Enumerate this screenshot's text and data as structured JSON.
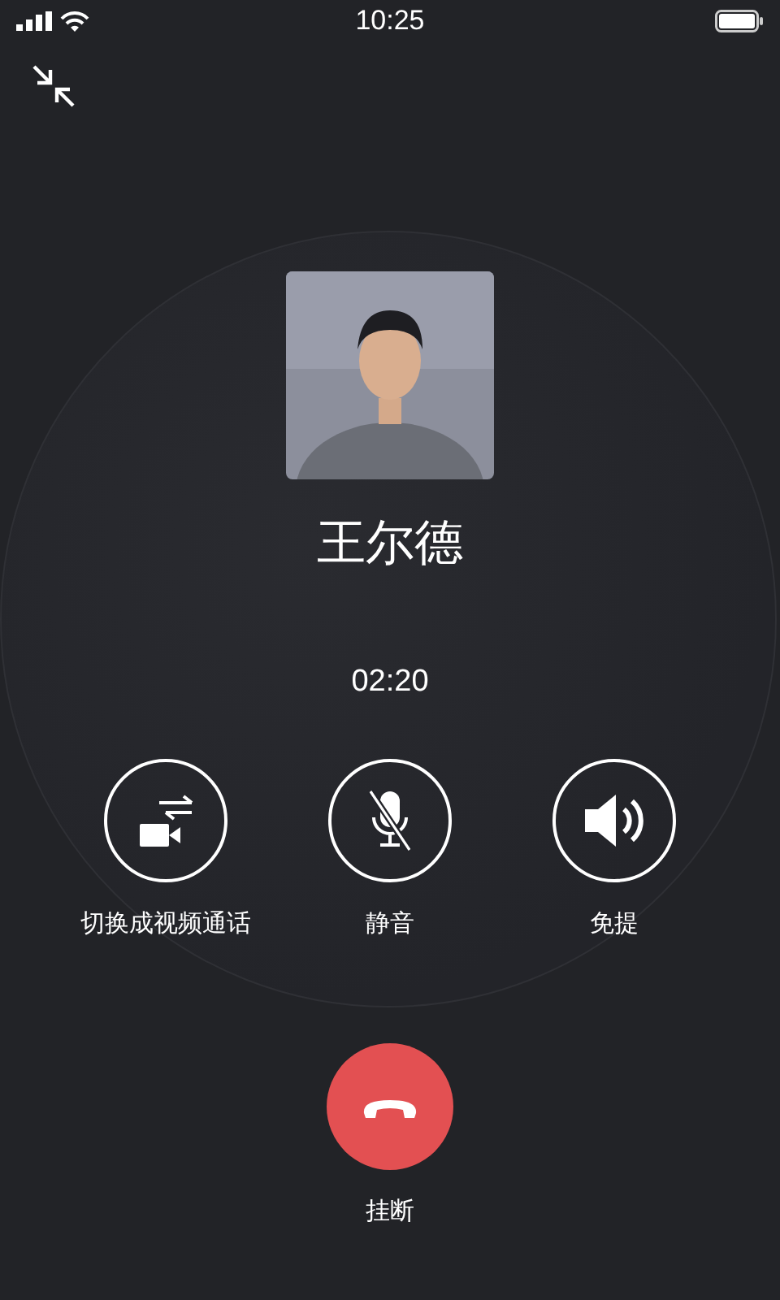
{
  "status_bar": {
    "time": "10:25"
  },
  "contact": {
    "name": "王尔德"
  },
  "call_duration": "02:20",
  "actions": [
    {
      "kind": "video",
      "label": "切换成视频通话"
    },
    {
      "kind": "mute",
      "label": "静音"
    },
    {
      "kind": "speaker",
      "label": "免提"
    }
  ],
  "hangup": {
    "label": "挂断"
  }
}
